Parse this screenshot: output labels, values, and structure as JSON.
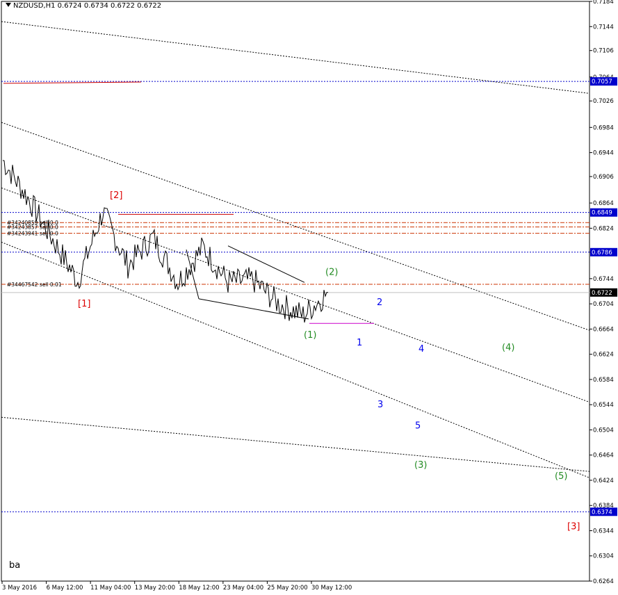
{
  "header": {
    "symbol": "NZDUSD,H1",
    "ohlc": "0.6724 0.6734 0.6722 0.6722"
  },
  "corner_label": "ba",
  "chart_data": {
    "type": "line",
    "title": "NZDUSD,H1",
    "ylim": [
      0.6264,
      0.7184
    ],
    "yticks": [
      "0.7184",
      "0.7144",
      "0.7106",
      "0.7064",
      "0.7026",
      "0.6984",
      "0.6944",
      "0.6906",
      "0.6864",
      "0.6824",
      "0.6786",
      "0.6744",
      "0.6704",
      "0.6664",
      "0.6624",
      "0.6584",
      "0.6544",
      "0.6504",
      "0.6464",
      "0.6424",
      "0.6384",
      "0.6344",
      "0.6304",
      "0.6264"
    ],
    "xticks": [
      "3 May 2016",
      "6 May 12:00",
      "11 May 04:00",
      "13 May 20:00",
      "18 May 12:00",
      "23 May 04:00",
      "25 May 20:00",
      "30 May 12:00"
    ],
    "x_points": [
      "3 May 2016",
      "6 May 12:00",
      "11 May 04:00",
      "13 May 20:00",
      "18 May 12:00",
      "23 May 04:00",
      "25 May 20:00",
      "30 May 12:00"
    ],
    "series": [
      {
        "values": [
          0.6932,
          0.6872,
          0.6806,
          0.674,
          0.685,
          0.6765,
          0.681,
          0.6738,
          0.6794,
          0.6738,
          0.6742,
          0.6705,
          0.6686,
          0.6722
        ],
        "color": "#000000"
      }
    ],
    "price_labels": [
      {
        "value": "0.7057",
        "price": 0.7057,
        "color": "#0000cc"
      },
      {
        "value": "0.6849",
        "price": 0.6849,
        "color": "#0000cc"
      },
      {
        "value": "0.6786",
        "price": 0.6786,
        "color": "#0000cc"
      },
      {
        "value": "0.6722",
        "price": 0.6722,
        "color": "#000000"
      },
      {
        "value": "0.6374",
        "price": 0.6374,
        "color": "#0000cc"
      }
    ],
    "order_labels": [
      {
        "text": "#34240859 sell 0.0",
        "price": 0.6833
      },
      {
        "text": "#34243857 sell 0.0",
        "price": 0.6826
      },
      {
        "text": "#34243941 sell 0.0",
        "price": 0.6816
      },
      {
        "text": "#34467542 sell 0.01",
        "price": 0.6735
      }
    ],
    "wave_labels": [
      {
        "text": "[1]",
        "color": "#dd0000"
      },
      {
        "text": "[2]",
        "color": "#dd0000"
      },
      {
        "text": "[3]",
        "color": "#dd0000"
      },
      {
        "text": "(1)",
        "color": "#228b22"
      },
      {
        "text": "(2)",
        "color": "#228b22"
      },
      {
        "text": "(3)",
        "color": "#228b22"
      },
      {
        "text": "(4)",
        "color": "#228b22"
      },
      {
        "text": "(5)",
        "color": "#228b22"
      },
      {
        "text": "1",
        "color": "#0000ee"
      },
      {
        "text": "2",
        "color": "#0000ee"
      },
      {
        "text": "3",
        "color": "#0000ee"
      },
      {
        "text": "4",
        "color": "#0000ee"
      },
      {
        "text": "5",
        "color": "#0000ee"
      }
    ],
    "colors": {
      "background": "#ffffff",
      "grid": "none",
      "level_line": "#0000cc",
      "order_line": "#cc3300",
      "red_line": "#cc0000",
      "magenta_line": "#cc00cc"
    }
  }
}
